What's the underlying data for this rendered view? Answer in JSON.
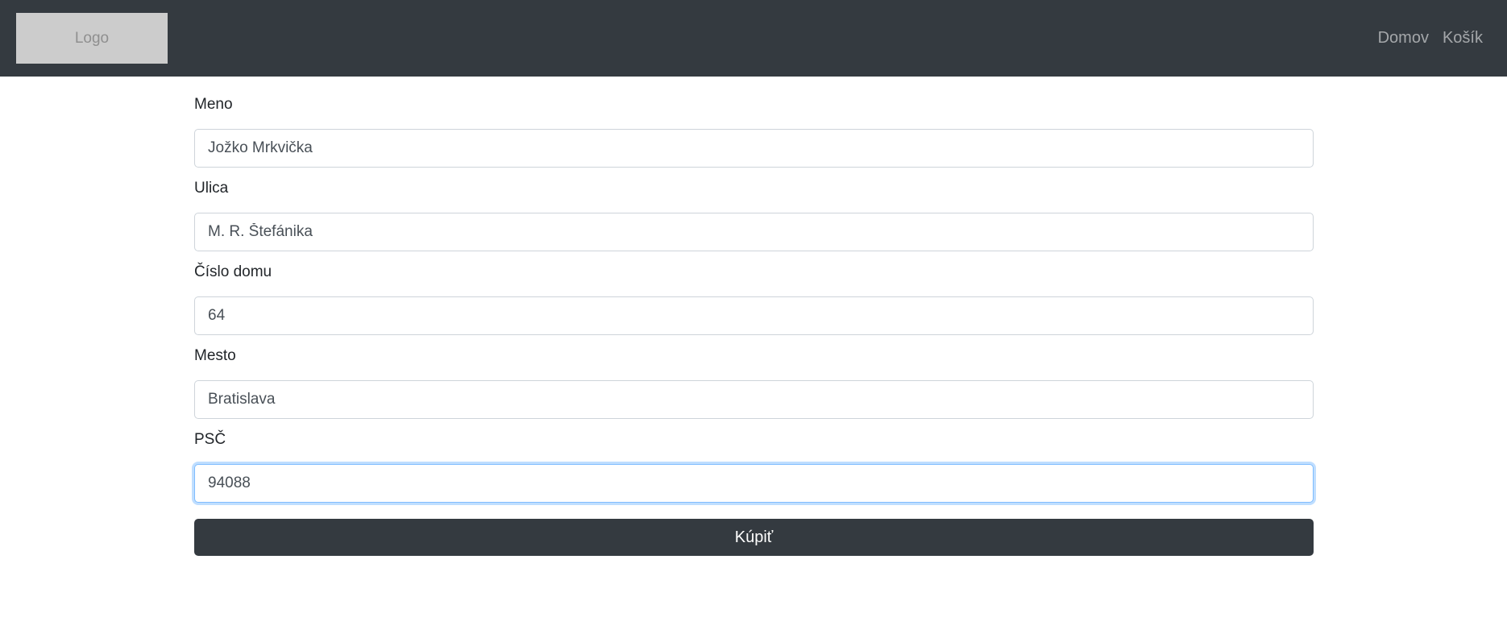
{
  "navbar": {
    "logo_text": "Logo",
    "links": [
      {
        "label": "Domov"
      },
      {
        "label": "Košík"
      }
    ]
  },
  "form": {
    "fields": [
      {
        "label": "Meno",
        "value": "Jožko Mrkvička"
      },
      {
        "label": "Ulica",
        "value": "M. R. Štefánika"
      },
      {
        "label": "Číslo domu",
        "value": "64"
      },
      {
        "label": "Mesto",
        "value": "Bratislava"
      },
      {
        "label": "PSČ",
        "value": "94088",
        "focused": true
      }
    ],
    "submit_label": "Kúpiť"
  },
  "colors": {
    "navbar_bg": "#343a40",
    "button_bg": "#343a40",
    "focus_border": "#80bdff"
  }
}
